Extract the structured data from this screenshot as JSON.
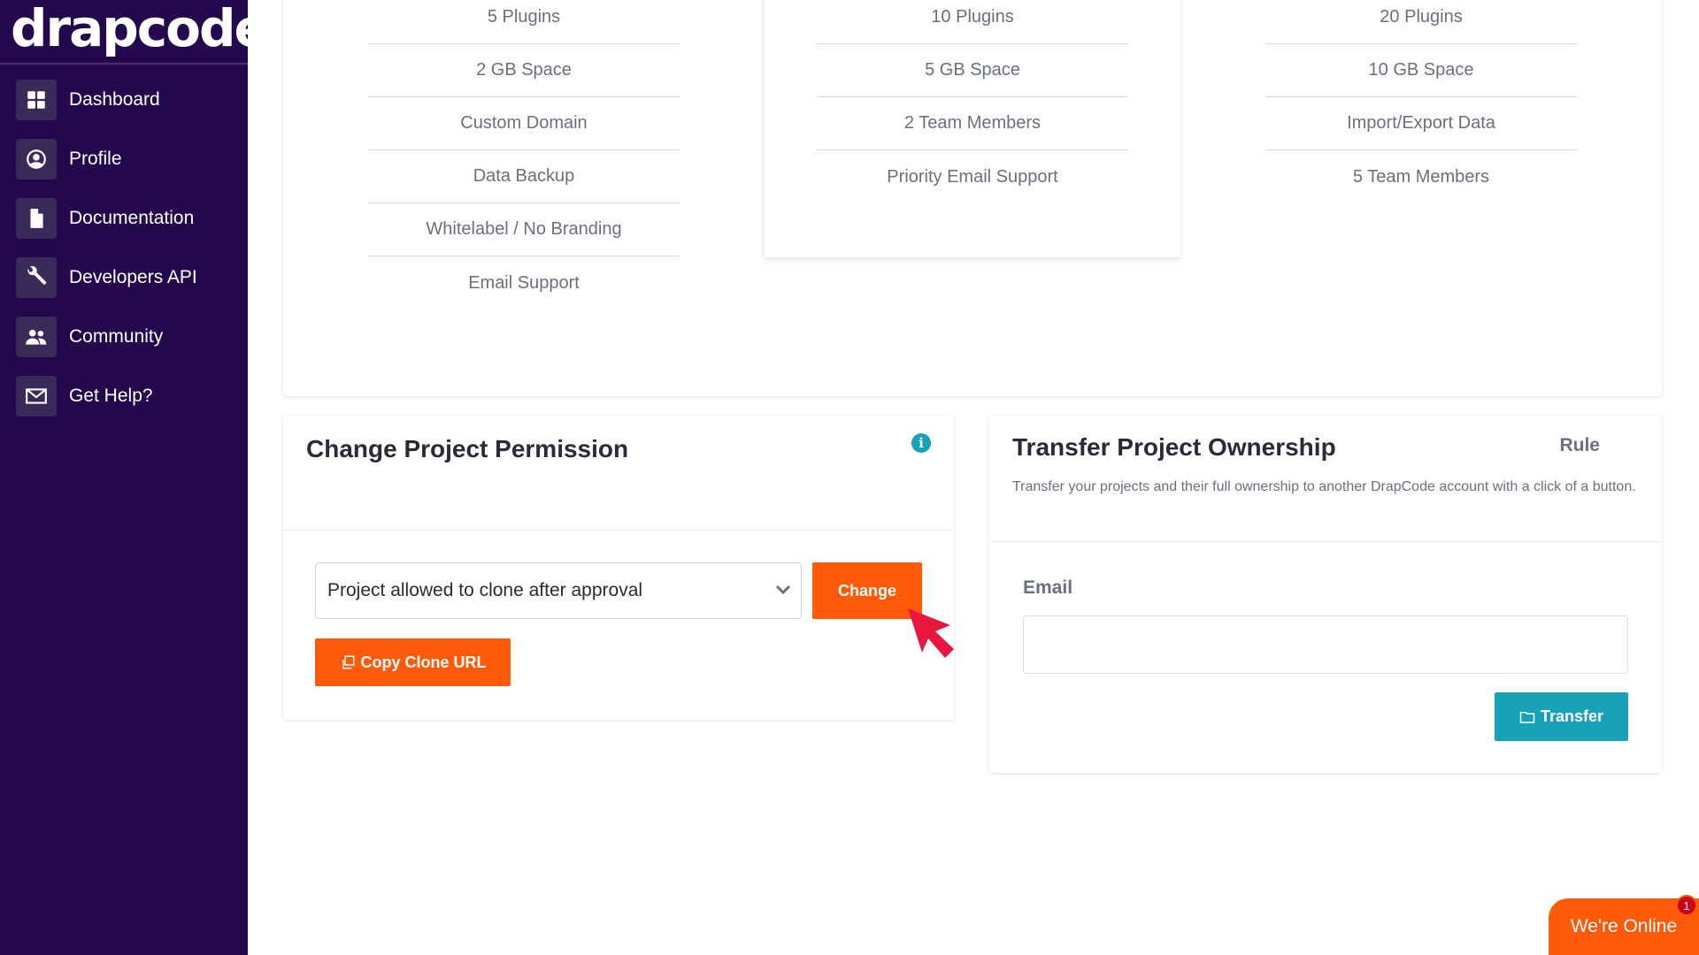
{
  "app": {
    "logo_text": "drapcode"
  },
  "sidebar": {
    "items": [
      {
        "label": "Dashboard",
        "icon": "dashboard-icon"
      },
      {
        "label": "Profile",
        "icon": "user-circle-icon"
      },
      {
        "label": "Documentation",
        "icon": "document-icon"
      },
      {
        "label": "Developers API",
        "icon": "wrench-icon"
      },
      {
        "label": "Community",
        "icon": "users-icon"
      },
      {
        "label": "Get Help?",
        "icon": "envelope-icon"
      }
    ]
  },
  "plans": [
    {
      "features": [
        "5 Plugins",
        "2 GB Space",
        "Custom Domain",
        "Data Backup",
        "Whitelabel / No Branding",
        "Email Support"
      ]
    },
    {
      "features": [
        "10 Plugins",
        "5 GB Space",
        "2 Team Members",
        "Priority Email Support"
      ]
    },
    {
      "features": [
        "20 Plugins",
        "10 GB Space",
        "Import/Export Data",
        "5 Team Members"
      ]
    }
  ],
  "permission": {
    "title": "Change Project Permission",
    "info_icon": "info-icon",
    "select_value": "Project allowed to clone after approval",
    "change_label": "Change",
    "copy_label": "Copy Clone URL"
  },
  "transfer": {
    "title": "Transfer Project Ownership",
    "rule_label": "Rule",
    "description": "Transfer your projects and their full ownership to another DrapCode account with a click of a button.",
    "email_label": "Email",
    "email_value": "",
    "transfer_label": "Transfer"
  },
  "chat": {
    "label": "We're Online",
    "badge_count": "1"
  },
  "colors": {
    "sidebar": "#23084d",
    "accent_orange": "#ff5a0a",
    "accent_teal": "#17a2b8",
    "cursor": "#e8173f"
  }
}
